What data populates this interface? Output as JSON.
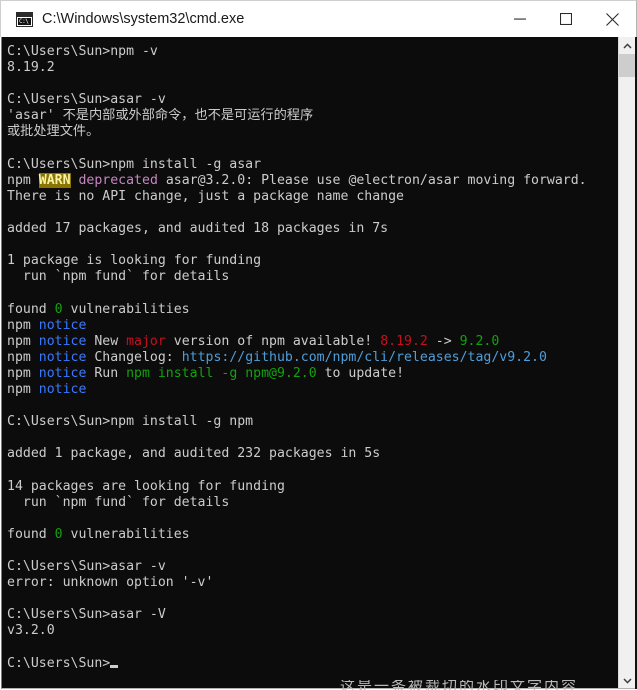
{
  "window": {
    "title": "C:\\Windows\\system32\\cmd.exe",
    "icon_name": "cmd-icon",
    "icon_glyph": "C:\\",
    "controls": {
      "minimize_label": "Minimize",
      "maximize_label": "Maximize",
      "close_label": "Close"
    }
  },
  "colors": {
    "background": "#0c0c0c",
    "foreground": "#cccccc",
    "green": "#13a10e",
    "red": "#c50f1f",
    "blue": "#3b78ff",
    "cyan": "#4f9dd9",
    "magenta": "#c586c0",
    "warn_bg": "#8a7500",
    "warn_fg": "#f9f1a5",
    "titlebar_bg": "#ffffff",
    "scrollbar_track": "#f0f0f0",
    "scrollbar_thumb": "#cdcdcd"
  },
  "scrollbar": {
    "up_arrow": "⌃",
    "down_arrow": "⌄",
    "thumb_label": "scroll-thumb"
  },
  "watermark": {
    "text": "这是一条被裁切的水印文字内容"
  },
  "console": {
    "prompt": "C:\\Users\\Sun>",
    "cursor": "block",
    "lines": [
      {
        "id": "l01",
        "segs": [
          {
            "t": "C:\\Users\\Sun>npm -v",
            "c": "c-default"
          }
        ]
      },
      {
        "id": "l02",
        "segs": [
          {
            "t": "8.19.2",
            "c": "c-default"
          }
        ]
      },
      {
        "id": "l03",
        "segs": [
          {
            "t": "",
            "c": "c-default"
          }
        ]
      },
      {
        "id": "l04",
        "segs": [
          {
            "t": "C:\\Users\\Sun>asar -v",
            "c": "c-default"
          }
        ]
      },
      {
        "id": "l05",
        "segs": [
          {
            "t": "'asar' 不是内部或外部命令，也不是可运行的程序",
            "c": "c-default"
          }
        ]
      },
      {
        "id": "l06",
        "segs": [
          {
            "t": "或批处理文件。",
            "c": "c-default"
          }
        ]
      },
      {
        "id": "l07",
        "segs": [
          {
            "t": "",
            "c": "c-default"
          }
        ]
      },
      {
        "id": "l08",
        "segs": [
          {
            "t": "C:\\Users\\Sun>npm install -g asar",
            "c": "c-default"
          }
        ]
      },
      {
        "id": "l09",
        "segs": [
          {
            "t": "npm ",
            "c": "c-default"
          },
          {
            "t": "WARN",
            "c": "c-warn"
          },
          {
            "t": " ",
            "c": "c-default"
          },
          {
            "t": "deprecated",
            "c": "c-magenta"
          },
          {
            "t": " asar@3.2.0: Please use @electron/asar moving forward.",
            "c": "c-default"
          }
        ]
      },
      {
        "id": "l10",
        "segs": [
          {
            "t": "There is no API change, just a package name change",
            "c": "c-default"
          }
        ]
      },
      {
        "id": "l11",
        "segs": [
          {
            "t": "",
            "c": "c-default"
          }
        ]
      },
      {
        "id": "l12",
        "segs": [
          {
            "t": "added 17 packages, and audited 18 packages in 7s",
            "c": "c-default"
          }
        ]
      },
      {
        "id": "l13",
        "segs": [
          {
            "t": "",
            "c": "c-default"
          }
        ]
      },
      {
        "id": "l14",
        "segs": [
          {
            "t": "1 package is looking for funding",
            "c": "c-default"
          }
        ]
      },
      {
        "id": "l15",
        "segs": [
          {
            "t": "  run `npm fund` for details",
            "c": "c-default"
          }
        ]
      },
      {
        "id": "l16",
        "segs": [
          {
            "t": "",
            "c": "c-default"
          }
        ]
      },
      {
        "id": "l17",
        "segs": [
          {
            "t": "found ",
            "c": "c-default"
          },
          {
            "t": "0",
            "c": "c-green"
          },
          {
            "t": " vulnerabilities",
            "c": "c-default"
          }
        ]
      },
      {
        "id": "l18",
        "segs": [
          {
            "t": "npm ",
            "c": "c-default"
          },
          {
            "t": "notice",
            "c": "c-blue"
          }
        ]
      },
      {
        "id": "l19",
        "segs": [
          {
            "t": "npm ",
            "c": "c-default"
          },
          {
            "t": "notice",
            "c": "c-blue"
          },
          {
            "t": " New ",
            "c": "c-default"
          },
          {
            "t": "major",
            "c": "c-red"
          },
          {
            "t": " version of npm available! ",
            "c": "c-default"
          },
          {
            "t": "8.19.2",
            "c": "c-red"
          },
          {
            "t": " -> ",
            "c": "c-default"
          },
          {
            "t": "9.2.0",
            "c": "c-green"
          }
        ]
      },
      {
        "id": "l20",
        "segs": [
          {
            "t": "npm ",
            "c": "c-default"
          },
          {
            "t": "notice",
            "c": "c-blue"
          },
          {
            "t": " Changelog: ",
            "c": "c-default"
          },
          {
            "t": "https://github.com/npm/cli/releases/tag/v9.2.0",
            "c": "c-cyan"
          }
        ]
      },
      {
        "id": "l21",
        "segs": [
          {
            "t": "npm ",
            "c": "c-default"
          },
          {
            "t": "notice",
            "c": "c-blue"
          },
          {
            "t": " Run ",
            "c": "c-default"
          },
          {
            "t": "npm install -g npm@9.2.0",
            "c": "c-green"
          },
          {
            "t": " to update!",
            "c": "c-default"
          }
        ]
      },
      {
        "id": "l22",
        "segs": [
          {
            "t": "npm ",
            "c": "c-default"
          },
          {
            "t": "notice",
            "c": "c-blue"
          }
        ]
      },
      {
        "id": "l23",
        "segs": [
          {
            "t": "",
            "c": "c-default"
          }
        ]
      },
      {
        "id": "l24",
        "segs": [
          {
            "t": "C:\\Users\\Sun>npm install -g npm",
            "c": "c-default"
          }
        ]
      },
      {
        "id": "l25",
        "segs": [
          {
            "t": "",
            "c": "c-default"
          }
        ]
      },
      {
        "id": "l26",
        "segs": [
          {
            "t": "added 1 package, and audited 232 packages in 5s",
            "c": "c-default"
          }
        ]
      },
      {
        "id": "l27",
        "segs": [
          {
            "t": "",
            "c": "c-default"
          }
        ]
      },
      {
        "id": "l28",
        "segs": [
          {
            "t": "14 packages are looking for funding",
            "c": "c-default"
          }
        ]
      },
      {
        "id": "l29",
        "segs": [
          {
            "t": "  run `npm fund` for details",
            "c": "c-default"
          }
        ]
      },
      {
        "id": "l30",
        "segs": [
          {
            "t": "",
            "c": "c-default"
          }
        ]
      },
      {
        "id": "l31",
        "segs": [
          {
            "t": "found ",
            "c": "c-default"
          },
          {
            "t": "0",
            "c": "c-green"
          },
          {
            "t": " vulnerabilities",
            "c": "c-default"
          }
        ]
      },
      {
        "id": "l32",
        "segs": [
          {
            "t": "",
            "c": "c-default"
          }
        ]
      },
      {
        "id": "l33",
        "segs": [
          {
            "t": "C:\\Users\\Sun>asar -v",
            "c": "c-default"
          }
        ]
      },
      {
        "id": "l34",
        "segs": [
          {
            "t": "error: unknown option '-v'",
            "c": "c-default"
          }
        ]
      },
      {
        "id": "l35",
        "segs": [
          {
            "t": "",
            "c": "c-default"
          }
        ]
      },
      {
        "id": "l36",
        "segs": [
          {
            "t": "C:\\Users\\Sun>asar -V",
            "c": "c-default"
          }
        ]
      },
      {
        "id": "l37",
        "segs": [
          {
            "t": "v3.2.0",
            "c": "c-default"
          }
        ]
      },
      {
        "id": "l38",
        "segs": [
          {
            "t": "",
            "c": "c-default"
          }
        ]
      },
      {
        "id": "l39",
        "segs": [
          {
            "t": "C:\\Users\\Sun>",
            "c": "c-default"
          }
        ],
        "cursor": true
      }
    ]
  }
}
